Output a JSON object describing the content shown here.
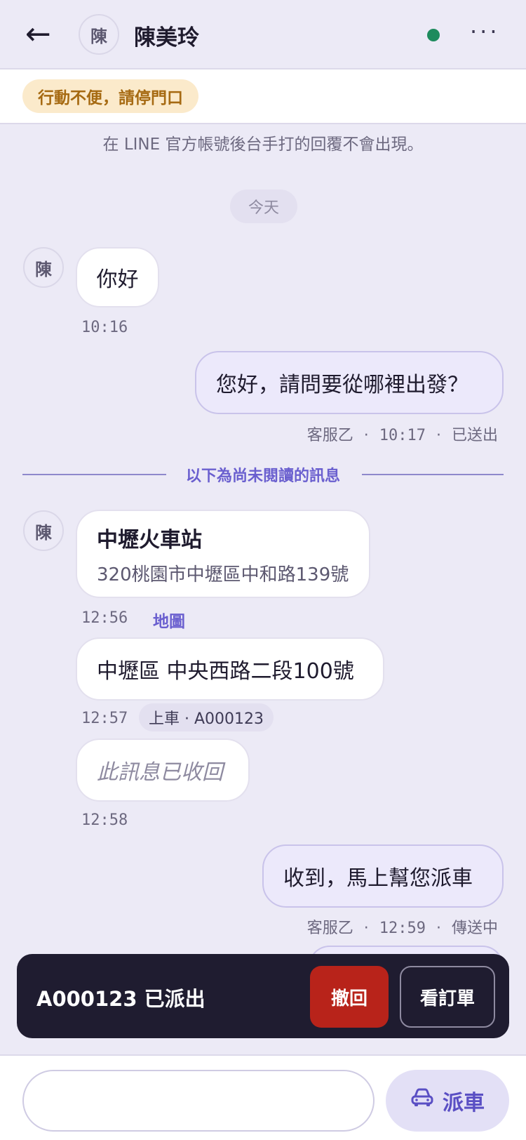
{
  "header": {
    "back_icon": "arrow-left-icon",
    "back_glyph": "←",
    "avatar_char": "陳",
    "contact_name": "陳美玲",
    "status_color": "#1e8b5d",
    "more_icon": "more-horizontal-icon",
    "more_glyph": "···"
  },
  "note": {
    "text": "行動不便，請停門口"
  },
  "info_text": "在 LINE 官方帳號後台手打的回覆不會出現。",
  "date_label": "今天",
  "unread_divider": "以下為尚未閱讀的訊息",
  "messages": [
    {
      "direction": "in",
      "avatar": "陳",
      "text": "你好",
      "time": "10:16"
    },
    {
      "direction": "out",
      "text": "您好，請問要從哪裡出發？",
      "agent": "客服乙",
      "time": "10:17",
      "status": "已送出"
    },
    {
      "direction": "in",
      "avatar": "陳",
      "type": "location",
      "title": "中壢火車站",
      "address": "320桃園市中壢區中和路139號",
      "time": "12:56",
      "link": "地圖"
    },
    {
      "direction": "in",
      "text": "中壢區 中央西路二段100號",
      "time": "12:57",
      "tag": "上車 · A000123"
    },
    {
      "direction": "in",
      "text": "此訊息已收回",
      "time": "12:58",
      "recalled": true
    },
    {
      "direction": "out",
      "text": "收到，馬上幫您派車",
      "agent": "客服乙",
      "time": "12:59",
      "status": "傳送中"
    }
  ],
  "meta_separator": "·",
  "toast": {
    "text": "A000123 已派出",
    "undo_label": "撤回",
    "view_order_label": "看訂單"
  },
  "composer": {
    "placeholder": "",
    "dispatch_label": "派車",
    "dispatch_icon": "car-icon"
  },
  "colors": {
    "background": "#eceaf6",
    "accent": "#6a5fcf",
    "note_bg": "#fbeacb",
    "note_text": "#a66a12",
    "undo": "#b8231a",
    "toast_bg": "#1f1c30"
  }
}
